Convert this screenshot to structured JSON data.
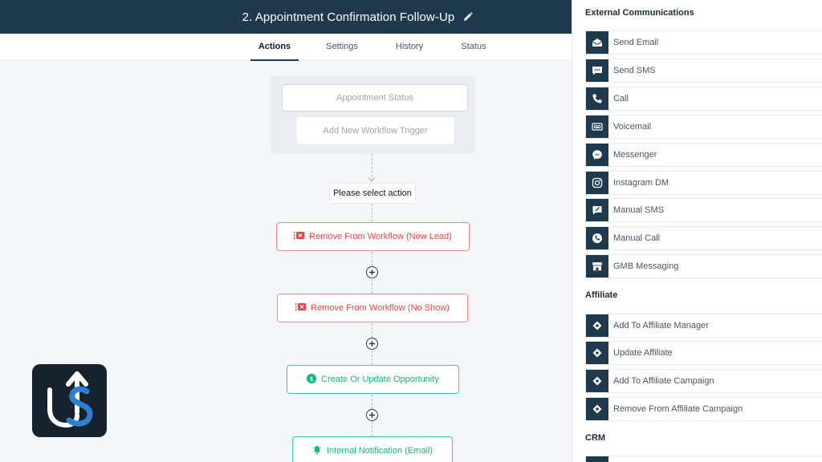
{
  "header": {
    "title": "2. Appointment Confirmation Follow-Up",
    "edit_icon": "pencil-icon"
  },
  "tabs": [
    {
      "label": "Actions",
      "active": true
    },
    {
      "label": "Settings",
      "active": false
    },
    {
      "label": "History",
      "active": false
    },
    {
      "label": "Status",
      "active": false
    }
  ],
  "workflow": {
    "trigger": "Appointment Status",
    "add_trigger": "Add New Workflow Trigger",
    "select_action": "Please select action",
    "actions": [
      {
        "label": "Remove From Workflow (New Lead)",
        "icon": "remove-workflow-icon",
        "color": "#ef4444"
      },
      {
        "label": "Remove From Workflow (No Show)",
        "icon": "remove-workflow-icon",
        "color": "#ef4444"
      },
      {
        "label": "Create Or Update Opportunity",
        "icon": "dollar-icon",
        "color": "#10b981"
      },
      {
        "label": "Internal Notification (Email)",
        "icon": "bell-icon",
        "color": "#10b981"
      }
    ]
  },
  "sidebar": {
    "sections": [
      {
        "title": "External Communications",
        "items": [
          {
            "label": "Send Email",
            "icon": "email-icon"
          },
          {
            "label": "Send SMS",
            "icon": "sms-icon"
          },
          {
            "label": "Call",
            "icon": "phone-icon"
          },
          {
            "label": "Voicemail",
            "icon": "voicemail-icon"
          },
          {
            "label": "Messenger",
            "icon": "messenger-icon"
          },
          {
            "label": "Instagram DM",
            "icon": "instagram-icon"
          },
          {
            "label": "Manual SMS",
            "icon": "manual-sms-icon"
          },
          {
            "label": "Manual Call",
            "icon": "manual-call-icon"
          },
          {
            "label": "GMB Messaging",
            "icon": "store-icon"
          }
        ]
      },
      {
        "title": "Affiliate",
        "items": [
          {
            "label": "Add To Affiliate Manager",
            "icon": "diamond-icon"
          },
          {
            "label": "Update Affiliate",
            "icon": "diamond-icon"
          },
          {
            "label": "Add To Affiliate Campaign",
            "icon": "diamond-icon"
          },
          {
            "label": "Remove From Affiliate Campaign",
            "icon": "diamond-icon"
          }
        ]
      },
      {
        "title": "CRM",
        "items": []
      }
    ]
  },
  "colors": {
    "header": "#1f3a4d",
    "danger": "#ef4444",
    "success": "#10b981",
    "logo_bg": "#16232e",
    "logo_accent": "#2f7fd0"
  }
}
